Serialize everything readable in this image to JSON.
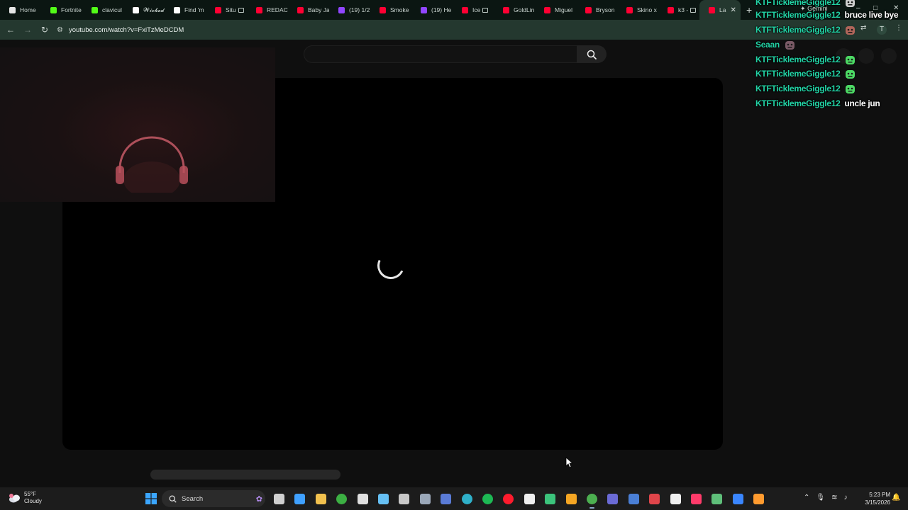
{
  "browser": {
    "tabs": [
      {
        "label": "Home",
        "favicon": "x-icon",
        "color": "#e6e6e6",
        "media": false
      },
      {
        "label": "Fortnite",
        "favicon": "kick-icon",
        "color": "#53fc18",
        "media": false
      },
      {
        "label": "clavicul",
        "favicon": "kick-icon",
        "color": "#53fc18",
        "media": false
      },
      {
        "label": "𝓦𝓲𝓬𝓴𝓮𝓭",
        "favicon": "tiktok-icon",
        "color": "#ffffff",
        "media": false
      },
      {
        "label": "Find 'm",
        "favicon": "tiktok-icon",
        "color": "#ffffff",
        "media": false
      },
      {
        "label": "Situ",
        "favicon": "youtube-icon",
        "color": "#ff0033",
        "media": true
      },
      {
        "label": "REDAC",
        "favicon": "youtube-icon",
        "color": "#ff0033",
        "media": false
      },
      {
        "label": "Baby Ja",
        "favicon": "youtube-icon",
        "color": "#ff0033",
        "media": false
      },
      {
        "label": "(19) 1/2",
        "favicon": "twitch-icon",
        "color": "#9146ff",
        "media": false
      },
      {
        "label": "Smoke",
        "favicon": "youtube-icon",
        "color": "#ff0033",
        "media": false
      },
      {
        "label": "(19) He",
        "favicon": "twitch-icon",
        "color": "#9146ff",
        "media": false
      },
      {
        "label": "Ice",
        "favicon": "youtube-icon",
        "color": "#ff0033",
        "media": true
      },
      {
        "label": "GoldLin",
        "favicon": "youtube-icon",
        "color": "#ff0033",
        "media": false
      },
      {
        "label": "Miguel",
        "favicon": "youtube-icon",
        "color": "#ff0033",
        "media": false
      },
      {
        "label": "Bryson",
        "favicon": "youtube-icon",
        "color": "#ff0033",
        "media": false
      },
      {
        "label": "Skino x",
        "favicon": "youtube-icon",
        "color": "#ff0033",
        "media": false
      },
      {
        "label": "k3 -",
        "favicon": "youtube-icon",
        "color": "#ff0033",
        "media": true
      },
      {
        "label": "La",
        "favicon": "youtube-icon",
        "color": "#ff0033",
        "media": false,
        "active": true
      }
    ],
    "active_close": "✕",
    "new_tab": "+",
    "gemini_label": "Gemini",
    "url": "youtube.com/watch?v=FxiTzMeDCDM",
    "window": {
      "minimize": "–",
      "maximize": "□",
      "close": "✕"
    },
    "profile_initial": "T"
  },
  "page": {
    "search_placeholder": "",
    "search_icon": "search-icon",
    "player_state": "loading-spinner"
  },
  "chat": [
    {
      "user": "KTFTicklemeGiggle12",
      "message": "",
      "emote": "chat-emote-icon",
      "emote_color": "#cfcfcf"
    },
    {
      "user": "KTFTicklemeGiggle12",
      "message": "bruce live bye",
      "emote": "",
      "emote_color": ""
    },
    {
      "user": "KTFTicklemeGiggle12",
      "message": "",
      "emote": "face-emote-icon",
      "emote_color": "#b0655a"
    },
    {
      "user": "Seaan",
      "message": "",
      "emote": "pink-emote-icon",
      "emote_color": "#7a5a66"
    },
    {
      "user": "KTFTicklemeGiggle12",
      "message": "",
      "emote": "green-emote-icon",
      "emote_color": "#4cd964"
    },
    {
      "user": "KTFTicklemeGiggle12",
      "message": "",
      "emote": "green-emote-icon",
      "emote_color": "#4cd964"
    },
    {
      "user": "KTFTicklemeGiggle12",
      "message": "",
      "emote": "green-emote-icon",
      "emote_color": "#4cd964"
    },
    {
      "user": "KTFTicklemeGiggle12",
      "message": "uncle jun",
      "emote": "",
      "emote_color": ""
    }
  ],
  "taskbar": {
    "weather_temp": "55°F",
    "weather_desc": "Cloudy",
    "search_label": "Search",
    "apps": [
      {
        "name": "task-view-icon",
        "color": "#d0d0d0"
      },
      {
        "name": "copilot-icon",
        "color": "#3fa0ff"
      },
      {
        "name": "file-explorer-icon",
        "color": "#f2c14e"
      },
      {
        "name": "xbox-icon",
        "color": "#3cb043"
      },
      {
        "name": "epic-games-icon",
        "color": "#e0e0e0"
      },
      {
        "name": "steam-icon",
        "color": "#66c0f4"
      },
      {
        "name": "obs-icon",
        "color": "#c8c8c8"
      },
      {
        "name": "settings-icon",
        "color": "#9aa7b8"
      },
      {
        "name": "edge-dev-icon",
        "color": "#5a7bd6"
      },
      {
        "name": "edge-icon",
        "color": "#2fb0c9"
      },
      {
        "name": "spotify-icon",
        "color": "#1db954"
      },
      {
        "name": "opera-icon",
        "color": "#ff1b2d"
      },
      {
        "name": "capcut-icon",
        "color": "#f0f0f0"
      },
      {
        "name": "discord-icon",
        "color": "#3cc47c"
      },
      {
        "name": "messenger-icon",
        "color": "#f5a623"
      },
      {
        "name": "chrome-icon",
        "color": "#4caf50"
      },
      {
        "name": "notes-icon",
        "color": "#6b6bd6"
      },
      {
        "name": "vscode-icon",
        "color": "#4a7fd6"
      },
      {
        "name": "streamlabs-icon",
        "color": "#e0454a"
      },
      {
        "name": "capcut-alt-icon",
        "color": "#f0f0f0"
      },
      {
        "name": "tiktok-icon",
        "color": "#ff3b6a"
      },
      {
        "name": "webcam-icon",
        "color": "#5fbf7a"
      },
      {
        "name": "bluestacks-icon",
        "color": "#3a86ff"
      },
      {
        "name": "game-icon",
        "color": "#ff9b2f"
      }
    ],
    "clock_time": "5:23 PM",
    "clock_date": "3/15/2026"
  }
}
